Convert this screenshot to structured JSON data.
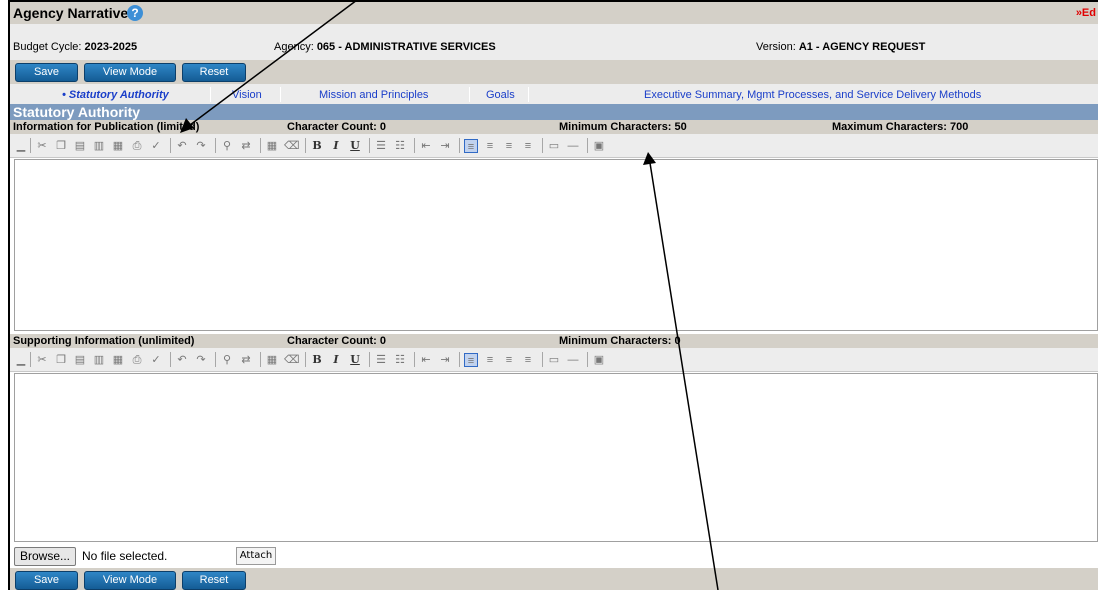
{
  "header": {
    "title": "Agency Narrative",
    "help_icon": "question-circle-icon",
    "edit_link": "»Ed"
  },
  "info": {
    "budget_label": "Budget Cycle:",
    "budget_value": "2023-2025",
    "agency_label": "Agency:",
    "agency_value": "065 - ADMINISTRATIVE SERVICES",
    "version_label": "Version:",
    "version_value": "A1 - AGENCY REQUEST"
  },
  "buttons": {
    "save": "Save",
    "view_mode": "View Mode",
    "reset": "Reset"
  },
  "tabs": [
    {
      "label": "• Statutory Authority",
      "active": true
    },
    {
      "label": "Vision",
      "active": false
    },
    {
      "label": "Mission and Principles",
      "active": false
    },
    {
      "label": "Goals",
      "active": false
    },
    {
      "label": "Executive Summary, Mgmt Processes, and Service Delivery Methods",
      "active": false
    }
  ],
  "section": {
    "title": "Statutory Authority"
  },
  "publication": {
    "label": "Information for Publication (limited)",
    "char_count": "Character Count: 0",
    "min_chars": "Minimum Characters: 50",
    "max_chars": "Maximum Characters: 700",
    "content": ""
  },
  "supporting": {
    "label": "Supporting Information (unlimited)",
    "char_count": "Character Count: 0",
    "min_chars": "Minimum Characters: 0",
    "content": ""
  },
  "upload": {
    "browse": "Browse...",
    "status": "No file selected.",
    "attach": "Attach"
  },
  "colors": {
    "button_blue": "#1a6fb0",
    "section_header": "#7d9bbf",
    "tab_link": "#1a3ec9",
    "edit_link": "#e00000"
  }
}
